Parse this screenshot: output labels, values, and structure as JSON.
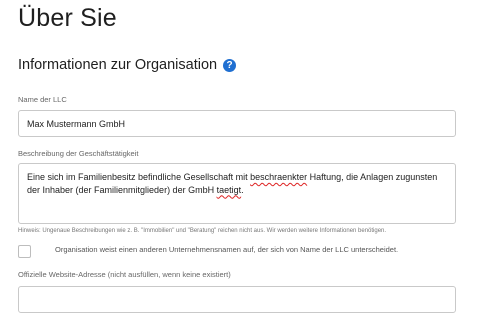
{
  "page": {
    "title": "Über Sie"
  },
  "section": {
    "title": "Informationen zur Organisation",
    "help_icon": "question-mark-circle-icon",
    "accent_color": "#1f6fd1"
  },
  "form": {
    "llc_name": {
      "label": "Name der LLC",
      "value": "Max Mustermann GmbH"
    },
    "business_description": {
      "label": "Beschreibung der Geschäftstätigkeit",
      "value_parts": {
        "a": "Eine sich im Familienbesitz befindliche Gesellschaft mit ",
        "b": "beschraenkter",
        "c": " Haftung, die Anlagen zugunsten der Inhaber (der Familienmitglieder) der GmbH ",
        "d": "taetigt",
        "e": "."
      },
      "hint": "Hinweis: Ungenaue Beschreibungen wie z. B. \"Immobilien\" und \"Beratung\" reichen nicht aus. Wir werden weitere Informationen benötigen."
    },
    "different_name": {
      "label": "Organisation weist einen anderen Unternehmensnamen auf, der sich von Name der LLC unterscheidet.",
      "checked": false
    },
    "website": {
      "label": "Offizielle Website-Adresse (nicht ausfüllen, wenn keine existiert)",
      "value": ""
    }
  }
}
